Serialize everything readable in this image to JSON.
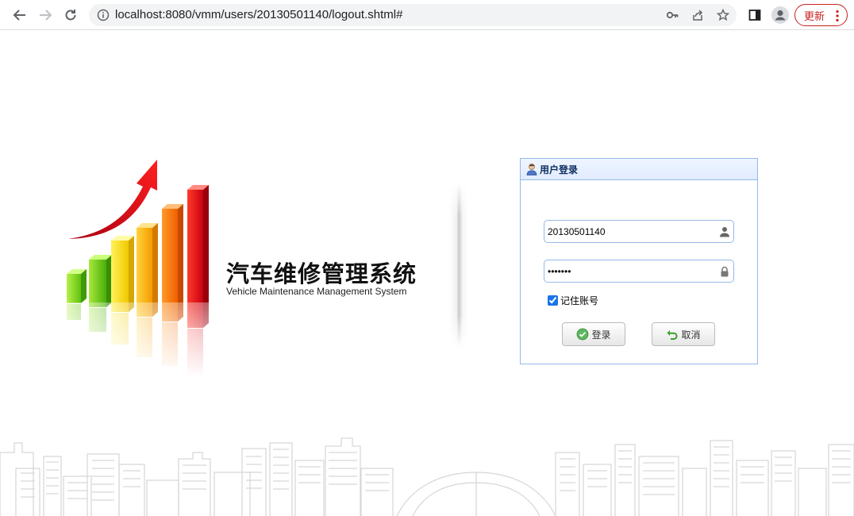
{
  "browser": {
    "url": "localhost:8080/vmm/users/20130501140/logout.shtml#",
    "update_label": "更新"
  },
  "brand": {
    "title": "汽车维修管理系统",
    "subtitle": "Vehicle Maintenance Management System"
  },
  "login": {
    "panel_title": "用户登录",
    "username_value": "20130501140",
    "password_value": "1234567",
    "remember_label": "记住账号",
    "remember_checked": true,
    "login_label": "登录",
    "cancel_label": "取消"
  },
  "colors": {
    "panel_border": "#95b8e7",
    "header_bg": "#e0ecff",
    "header_text": "#0e2d5f",
    "update_red": "#c5221f"
  }
}
